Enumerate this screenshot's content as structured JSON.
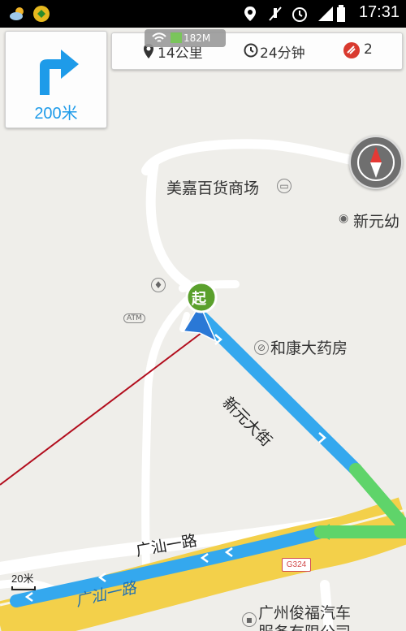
{
  "status_bar": {
    "time": "17:31",
    "icons": [
      "weather-icon",
      "app-icon",
      "location-icon",
      "mute-icon",
      "alarm-icon",
      "signal-icon",
      "battery-icon"
    ]
  },
  "network_badge": {
    "speed": "182M"
  },
  "turn_card": {
    "direction": "turn-right-arrow-icon",
    "distance": "200米"
  },
  "info_bar": {
    "distance": "14公里",
    "duration": "24分钟",
    "cameras": "2"
  },
  "map": {
    "pois": [
      {
        "name": "美嘉百货商场",
        "icon": "shopping-icon"
      },
      {
        "name": "新元幼",
        "icon": "poi-dot-icon"
      },
      {
        "name": "和康大药房",
        "icon": "pharmacy-icon"
      },
      {
        "name": "广州俊福汽车",
        "icon": "car-service-icon"
      },
      {
        "name": "服务有限公司",
        "icon": ""
      }
    ],
    "roads": [
      {
        "name": "新元大街"
      },
      {
        "name": "广汕一路"
      },
      {
        "name": "广汕一路"
      }
    ],
    "atm_label": "ATM",
    "start_marker": "起",
    "road_shield": "G324",
    "scale": "20米"
  },
  "colors": {
    "route_blue": "#34a8ee",
    "route_green": "#5fd46a",
    "highway_yellow": "#f3d04a",
    "accent_blue": "#1e9be9"
  }
}
